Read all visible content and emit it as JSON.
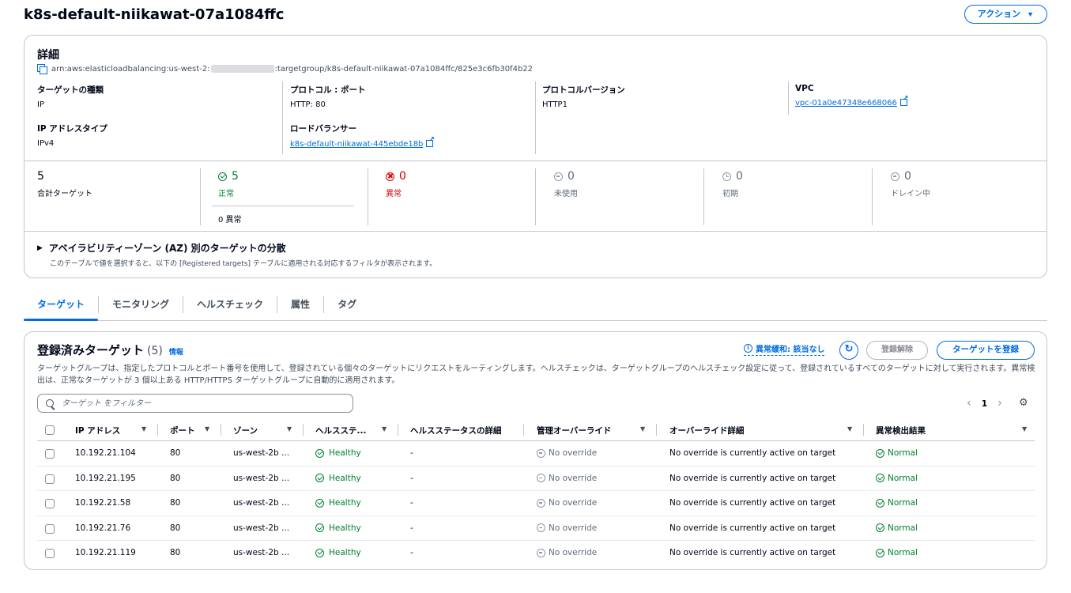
{
  "page": {
    "title": "k8s-default-niikawat-07a1084ffc",
    "actions_label": "アクション"
  },
  "details": {
    "heading": "詳細",
    "arn_prefix": "arn:aws:elasticloadbalancing:us-west-2:",
    "arn_suffix": ":targetgroup/k8s-default-niikawat-07a1084ffc/825e3c6fb30f4b22",
    "target_type_label": "ターゲットの種類",
    "target_type_value": "IP",
    "protocol_port_label": "プロトコル : ポート",
    "protocol_port_value": "HTTP: 80",
    "protocol_version_label": "プロトコルバージョン",
    "protocol_version_value": "HTTP1",
    "vpc_label": "VPC",
    "vpc_value": "vpc-01a0e47348e668066",
    "ip_type_label": "IP アドレスタイプ",
    "ip_type_value": "IPv4",
    "lb_label": "ロードバランサー",
    "lb_value": "k8s-default-niikawat-445ebde18b"
  },
  "stats": {
    "total_num": "5",
    "total_label": "合計ターゲット",
    "healthy_num": "5",
    "healthy_label": "正常",
    "healthy_sub": "0 異常",
    "unhealthy_num": "0",
    "unhealthy_label": "異常",
    "unused_num": "0",
    "unused_label": "未使用",
    "initial_num": "0",
    "initial_label": "初期",
    "draining_num": "0",
    "draining_label": "ドレイン中"
  },
  "az": {
    "title": "アベイラビリティーゾーン (AZ) 別のターゲットの分散",
    "desc": "このテーブルで値を選択すると、以下の [Registered targets] テーブルに適用される対応するフィルタが表示されます。"
  },
  "tabs": [
    "ターゲット",
    "モニタリング",
    "ヘルスチェック",
    "属性",
    "タグ"
  ],
  "targets": {
    "title": "登録済みターゲット",
    "count": "(5)",
    "info": "情報",
    "anomaly_label": "異常緩和: 該当なし",
    "deregister_label": "登録解除",
    "register_label": "ターゲットを登録",
    "desc": "ターゲットグループは、指定したプロトコルとポート番号を使用して、登録されている個々のターゲットにリクエストをルーティングします。ヘルスチェックは、ターゲットグループのヘルスチェック設定に従って、登録されているすべてのターゲットに対して実行されます。異常検出は、正常なターゲットが 3 個以上ある HTTP/HTTPS ターゲットグループに自動的に適用されます。",
    "filter_placeholder": "ターゲット をフィルター",
    "page": "1",
    "columns": {
      "ip": "IP アドレス",
      "port": "ポート",
      "zone": "ゾーン",
      "health": "ヘルスステ...",
      "health_detail": "ヘルスステータスの詳細",
      "override": "管理オーバーライド",
      "override_detail": "オーバーライド詳細",
      "anomaly": "異常検出結果"
    },
    "rows": [
      {
        "ip": "10.192.21.104",
        "port": "80",
        "zone": "us-west-2b ...",
        "health": "Healthy",
        "health_detail": "-",
        "override": "No override",
        "override_detail": "No override is currently active on target",
        "anomaly": "Normal"
      },
      {
        "ip": "10.192.21.195",
        "port": "80",
        "zone": "us-west-2b ...",
        "health": "Healthy",
        "health_detail": "-",
        "override": "No override",
        "override_detail": "No override is currently active on target",
        "anomaly": "Normal"
      },
      {
        "ip": "10.192.21.58",
        "port": "80",
        "zone": "us-west-2b ...",
        "health": "Healthy",
        "health_detail": "-",
        "override": "No override",
        "override_detail": "No override is currently active on target",
        "anomaly": "Normal"
      },
      {
        "ip": "10.192.21.76",
        "port": "80",
        "zone": "us-west-2b ...",
        "health": "Healthy",
        "health_detail": "-",
        "override": "No override",
        "override_detail": "No override is currently active on target",
        "anomaly": "Normal"
      },
      {
        "ip": "10.192.21.119",
        "port": "80",
        "zone": "us-west-2b ...",
        "health": "Healthy",
        "health_detail": "-",
        "override": "No override",
        "override_detail": "No override is currently active on target",
        "anomaly": "Normal"
      }
    ]
  }
}
